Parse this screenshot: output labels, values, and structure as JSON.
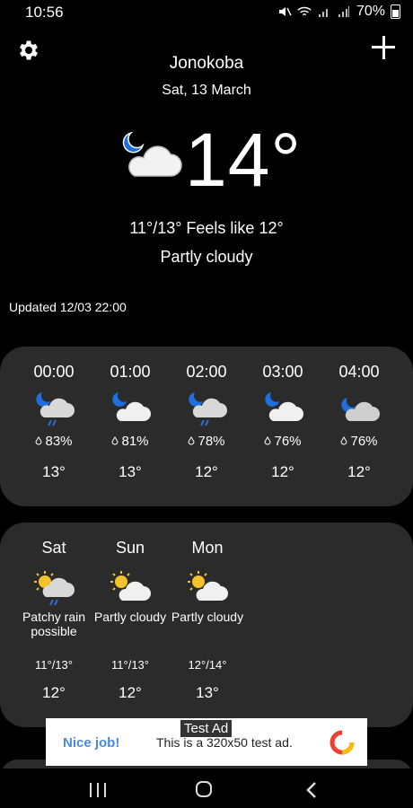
{
  "status": {
    "time": "10:56",
    "battery": "70%"
  },
  "header": {
    "city": "Jonokoba",
    "date": "Sat, 13 March"
  },
  "current": {
    "temp": "14°",
    "minmax": "11°/13° Feels like 12°",
    "condition": "Partly cloudy",
    "icon": "night-partly-cloudy-icon"
  },
  "updated": "Updated 12/03 22:00",
  "hourly": [
    {
      "time": "00:00",
      "humidity": "83%",
      "temp": "13°",
      "icon": "night-rain-icon"
    },
    {
      "time": "01:00",
      "humidity": "81%",
      "temp": "13°",
      "icon": "night-cloudy-icon"
    },
    {
      "time": "02:00",
      "humidity": "78%",
      "temp": "12°",
      "icon": "night-rain-icon"
    },
    {
      "time": "03:00",
      "humidity": "76%",
      "temp": "12°",
      "icon": "night-cloudy-icon"
    },
    {
      "time": "04:00",
      "humidity": "76%",
      "temp": "12°",
      "icon": "night-overcast-icon"
    }
  ],
  "daily": [
    {
      "day": "Sat",
      "condition": "Patchy rain possible",
      "minmax": "11°/13°",
      "temp": "12°",
      "icon": "day-rain-icon"
    },
    {
      "day": "Sun",
      "condition": "Partly cloudy",
      "minmax": "11°/13°",
      "temp": "12°",
      "icon": "day-partly-cloudy-icon"
    },
    {
      "day": "Mon",
      "condition": "Partly cloudy",
      "minmax": "12°/14°",
      "temp": "13°",
      "icon": "day-partly-cloudy-icon"
    }
  ],
  "ad": {
    "label": "Test Ad",
    "nice": "Nice job!",
    "text": "This is a 320x50 test ad."
  },
  "colors": {
    "background": "#000000",
    "card": "#2b2b2b",
    "moon": "#1e6fe0",
    "sun": "#f5c22a",
    "rain": "#2b6fd6"
  }
}
